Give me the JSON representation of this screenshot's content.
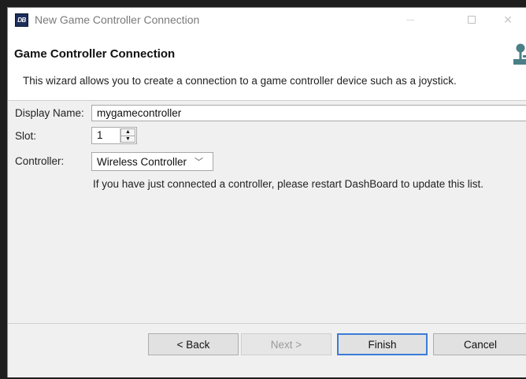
{
  "window": {
    "app_icon_text": "DB",
    "title": "New Game Controller Connection",
    "minimize": "—",
    "maximize": "☐",
    "close": "✕"
  },
  "banner": {
    "title": "Game Controller Connection",
    "description": "This wizard allows you to create a connection to a game controller device such as a joystick.",
    "icon": "joystick-icon"
  },
  "form": {
    "display_name_label": "Display Name:",
    "display_name_value": "mygamecontroller",
    "slot_label": "Slot:",
    "slot_value": "1",
    "controller_label": "Controller:",
    "controller_value": "Wireless Controller",
    "hint": "If you have just connected a controller, please restart DashBoard to update this list."
  },
  "buttons": {
    "back": "< Back",
    "next": "Next >",
    "finish": "Finish",
    "cancel": "Cancel"
  },
  "colors": {
    "accent": "#3a7dd8",
    "banner_bg": "#ffffff",
    "body_bg": "#f0f0f0"
  }
}
